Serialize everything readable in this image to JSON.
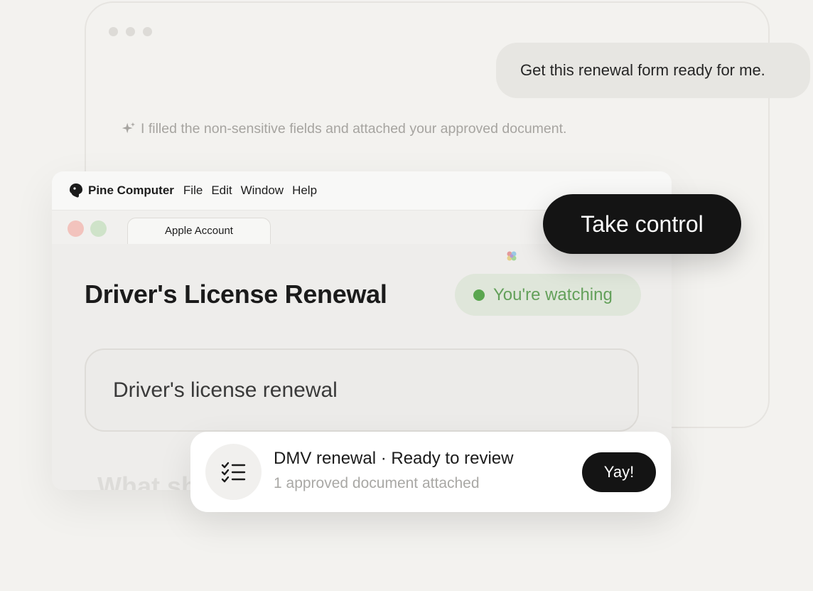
{
  "chat": {
    "user_message": "Get this renewal form ready for me.",
    "assistant_message": "I filled the non-sensitive fields and attached your approved document.",
    "assistant_icon": "sparkle-icon"
  },
  "app": {
    "menubar": {
      "app_name": "Pine Computer",
      "logo_icon": "pine-logo-icon",
      "items": [
        {
          "label": "File"
        },
        {
          "label": "Edit"
        },
        {
          "label": "Window"
        },
        {
          "label": "Help"
        }
      ]
    },
    "tab": {
      "label": "Apple Account"
    },
    "page": {
      "title": "Driver's License Renewal",
      "watch_status": "You're watching",
      "input_value": "Driver's license renewal",
      "next_question_partial": "What sh"
    }
  },
  "take_control": {
    "label": "Take control"
  },
  "toast": {
    "icon": "checklist-icon",
    "title": "DMV renewal · Ready to review",
    "subtitle": "1 approved document attached",
    "button_label": "Yay!"
  },
  "colors": {
    "background": "#f3f2ef",
    "status_green": "#5aa64f",
    "dark_button": "#141414",
    "traffic_red": "#f2c3bd",
    "traffic_green": "#cfe3c9"
  }
}
